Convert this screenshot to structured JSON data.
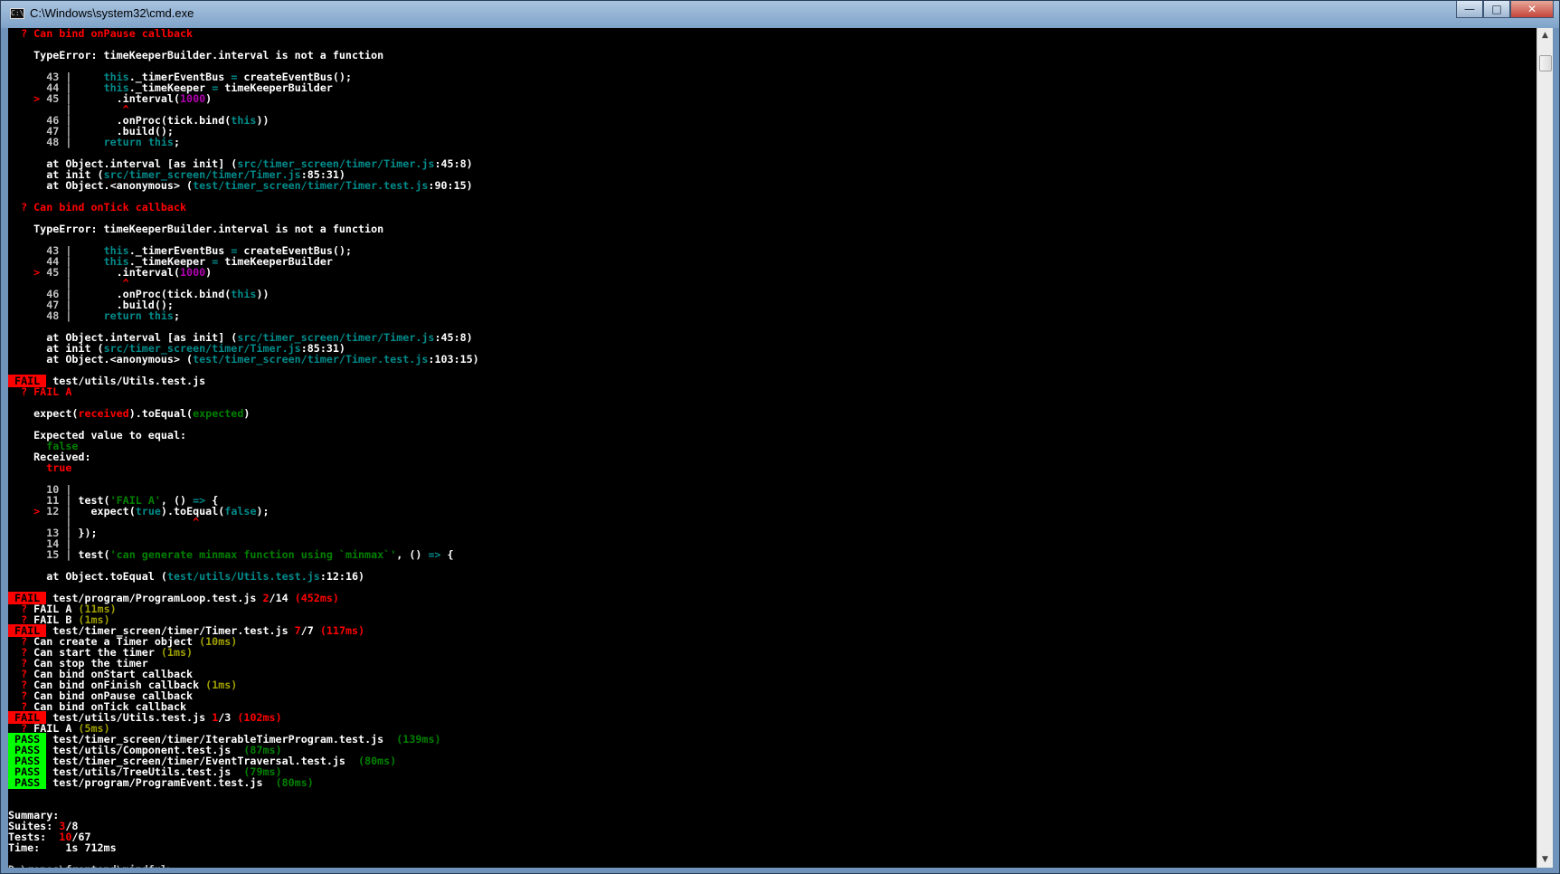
{
  "window": {
    "title": "C:\\Windows\\system32\\cmd.exe",
    "icon": "terminal-icon",
    "controls": {
      "minimize": "—",
      "maximize": "□",
      "close": "✕"
    }
  },
  "colors": {
    "background": "#000000",
    "default": "#c0c0c0",
    "bright": "#ffffff",
    "red": "#ff0000",
    "cyan": "#008b8b",
    "green": "#008000",
    "magenta": "#b000b0",
    "yellow": "#a0a000",
    "fail_badge_bg": "#ff0000",
    "pass_badge_bg": "#00ff00"
  },
  "console": {
    "lines": [
      [
        {
          "t": "  ? Can bind onPause callback",
          "c": "red"
        }
      ],
      [
        {
          "t": ""
        }
      ],
      [
        {
          "t": "    TypeError: timeKeeperBuilder.interval is not a function",
          "c": "bright"
        }
      ],
      [
        {
          "t": ""
        }
      ],
      [
        {
          "t": "      43 |     ",
          "c": "default"
        },
        {
          "t": "this",
          "c": "cyan"
        },
        {
          "t": "._timerEventBus ",
          "c": "bright"
        },
        {
          "t": "=",
          "c": "cyan"
        },
        {
          "t": " createEventBus();",
          "c": "bright"
        }
      ],
      [
        {
          "t": "      44 |     ",
          "c": "default"
        },
        {
          "t": "this",
          "c": "cyan"
        },
        {
          "t": "._timeKeeper ",
          "c": "bright"
        },
        {
          "t": "=",
          "c": "cyan"
        },
        {
          "t": " timeKeeperBuilder",
          "c": "bright"
        }
      ],
      [
        {
          "t": "    > ",
          "c": "red"
        },
        {
          "t": "45 |       ",
          "c": "default"
        },
        {
          "t": ".interval(",
          "c": "bright"
        },
        {
          "t": "1000",
          "c": "magenta"
        },
        {
          "t": ")",
          "c": "bright"
        }
      ],
      [
        {
          "t": "         |        ",
          "c": "default"
        },
        {
          "t": "^",
          "c": "red"
        }
      ],
      [
        {
          "t": "      46 |       ",
          "c": "default"
        },
        {
          "t": ".onProc(tick.bind(",
          "c": "bright"
        },
        {
          "t": "this",
          "c": "cyan"
        },
        {
          "t": "))",
          "c": "bright"
        }
      ],
      [
        {
          "t": "      47 |       ",
          "c": "default"
        },
        {
          "t": ".build();",
          "c": "bright"
        }
      ],
      [
        {
          "t": "      48 |     ",
          "c": "default"
        },
        {
          "t": "return this",
          "c": "cyan"
        },
        {
          "t": ";",
          "c": "bright"
        }
      ],
      [
        {
          "t": ""
        }
      ],
      [
        {
          "t": "      at Object.interval [as init] (",
          "c": "bright"
        },
        {
          "t": "src/timer_screen/timer/Timer.js",
          "c": "cyan"
        },
        {
          "t": ":45:8)",
          "c": "bright"
        }
      ],
      [
        {
          "t": "      at init (",
          "c": "bright"
        },
        {
          "t": "src/timer_screen/timer/Timer.js",
          "c": "cyan"
        },
        {
          "t": ":85:31)",
          "c": "bright"
        }
      ],
      [
        {
          "t": "      at Object.<anonymous> (",
          "c": "bright"
        },
        {
          "t": "test/timer_screen/timer/Timer.test.js",
          "c": "cyan"
        },
        {
          "t": ":90:15)",
          "c": "bright"
        }
      ],
      [
        {
          "t": ""
        }
      ],
      [
        {
          "t": "  ? Can bind onTick callback",
          "c": "red"
        }
      ],
      [
        {
          "t": ""
        }
      ],
      [
        {
          "t": "    TypeError: timeKeeperBuilder.interval is not a function",
          "c": "bright"
        }
      ],
      [
        {
          "t": ""
        }
      ],
      [
        {
          "t": "      43 |     ",
          "c": "default"
        },
        {
          "t": "this",
          "c": "cyan"
        },
        {
          "t": "._timerEventBus ",
          "c": "bright"
        },
        {
          "t": "=",
          "c": "cyan"
        },
        {
          "t": " createEventBus();",
          "c": "bright"
        }
      ],
      [
        {
          "t": "      44 |     ",
          "c": "default"
        },
        {
          "t": "this",
          "c": "cyan"
        },
        {
          "t": "._timeKeeper ",
          "c": "bright"
        },
        {
          "t": "=",
          "c": "cyan"
        },
        {
          "t": " timeKeeperBuilder",
          "c": "bright"
        }
      ],
      [
        {
          "t": "    > ",
          "c": "red"
        },
        {
          "t": "45 |       ",
          "c": "default"
        },
        {
          "t": ".interval(",
          "c": "bright"
        },
        {
          "t": "1000",
          "c": "magenta"
        },
        {
          "t": ")",
          "c": "bright"
        }
      ],
      [
        {
          "t": "         |        ",
          "c": "default"
        },
        {
          "t": "^",
          "c": "red"
        }
      ],
      [
        {
          "t": "      46 |       ",
          "c": "default"
        },
        {
          "t": ".onProc(tick.bind(",
          "c": "bright"
        },
        {
          "t": "this",
          "c": "cyan"
        },
        {
          "t": "))",
          "c": "bright"
        }
      ],
      [
        {
          "t": "      47 |       ",
          "c": "default"
        },
        {
          "t": ".build();",
          "c": "bright"
        }
      ],
      [
        {
          "t": "      48 |     ",
          "c": "default"
        },
        {
          "t": "return this",
          "c": "cyan"
        },
        {
          "t": ";",
          "c": "bright"
        }
      ],
      [
        {
          "t": ""
        }
      ],
      [
        {
          "t": "      at Object.interval [as init] (",
          "c": "bright"
        },
        {
          "t": "src/timer_screen/timer/Timer.js",
          "c": "cyan"
        },
        {
          "t": ":45:8)",
          "c": "bright"
        }
      ],
      [
        {
          "t": "      at init (",
          "c": "bright"
        },
        {
          "t": "src/timer_screen/timer/Timer.js",
          "c": "cyan"
        },
        {
          "t": ":85:31)",
          "c": "bright"
        }
      ],
      [
        {
          "t": "      at Object.<anonymous> (",
          "c": "bright"
        },
        {
          "t": "test/timer_screen/timer/Timer.test.js",
          "c": "cyan"
        },
        {
          "t": ":103:15)",
          "c": "bright"
        }
      ],
      [
        {
          "t": ""
        }
      ],
      [
        {
          "t": " FAIL ",
          "c": "fail"
        },
        {
          "t": " test/utils/",
          "c": "bright"
        },
        {
          "t": "Utils.test.js",
          "c": "bright"
        }
      ],
      [
        {
          "t": "  ? FAIL A",
          "c": "red"
        }
      ],
      [
        {
          "t": ""
        }
      ],
      [
        {
          "t": "    expect(",
          "c": "bright"
        },
        {
          "t": "received",
          "c": "red"
        },
        {
          "t": ").toEqual(",
          "c": "bright"
        },
        {
          "t": "expected",
          "c": "green"
        },
        {
          "t": ")",
          "c": "bright"
        }
      ],
      [
        {
          "t": ""
        }
      ],
      [
        {
          "t": "    Expected value to equal:",
          "c": "bright"
        }
      ],
      [
        {
          "t": "      false",
          "c": "green"
        }
      ],
      [
        {
          "t": "    Received:",
          "c": "bright"
        }
      ],
      [
        {
          "t": "      true",
          "c": "red"
        }
      ],
      [
        {
          "t": ""
        }
      ],
      [
        {
          "t": "      10 |",
          "c": "default"
        }
      ],
      [
        {
          "t": "      11 | ",
          "c": "default"
        },
        {
          "t": "test(",
          "c": "bright"
        },
        {
          "t": "'FAIL A'",
          "c": "green"
        },
        {
          "t": ", () ",
          "c": "bright"
        },
        {
          "t": "=>",
          "c": "cyan"
        },
        {
          "t": " {",
          "c": "bright"
        }
      ],
      [
        {
          "t": "    > ",
          "c": "red"
        },
        {
          "t": "12 |   ",
          "c": "default"
        },
        {
          "t": "expect(",
          "c": "bright"
        },
        {
          "t": "true",
          "c": "cyan"
        },
        {
          "t": ").toEqual(",
          "c": "bright"
        },
        {
          "t": "false",
          "c": "cyan"
        },
        {
          "t": ");",
          "c": "bright"
        }
      ],
      [
        {
          "t": "         |                   ",
          "c": "default"
        },
        {
          "t": "^",
          "c": "red"
        }
      ],
      [
        {
          "t": "      13 | ",
          "c": "default"
        },
        {
          "t": "});",
          "c": "bright"
        }
      ],
      [
        {
          "t": "      14 |",
          "c": "default"
        }
      ],
      [
        {
          "t": "      15 | ",
          "c": "default"
        },
        {
          "t": "test(",
          "c": "bright"
        },
        {
          "t": "'can generate minmax function using `minmax`'",
          "c": "green"
        },
        {
          "t": ", () ",
          "c": "bright"
        },
        {
          "t": "=>",
          "c": "cyan"
        },
        {
          "t": " {",
          "c": "bright"
        }
      ],
      [
        {
          "t": ""
        }
      ],
      [
        {
          "t": "      at Object.toEqual (",
          "c": "bright"
        },
        {
          "t": "test/utils/Utils.test.js",
          "c": "cyan"
        },
        {
          "t": ":12:16)",
          "c": "bright"
        }
      ],
      [
        {
          "t": ""
        }
      ],
      [
        {
          "t": " FAIL ",
          "c": "fail"
        },
        {
          "t": " test/program/",
          "c": "bright"
        },
        {
          "t": "ProgramLoop.test.js ",
          "c": "bright"
        },
        {
          "t": "2",
          "c": "red"
        },
        {
          "t": "/14 ",
          "c": "bright"
        },
        {
          "t": "(452ms)",
          "c": "red"
        }
      ],
      [
        {
          "t": "  ? ",
          "c": "red"
        },
        {
          "t": "FAIL A ",
          "c": "bright"
        },
        {
          "t": "(11ms)",
          "c": "yellow"
        }
      ],
      [
        {
          "t": "  ? ",
          "c": "red"
        },
        {
          "t": "FAIL B ",
          "c": "bright"
        },
        {
          "t": "(1ms)",
          "c": "yellow"
        }
      ],
      [
        {
          "t": " FAIL ",
          "c": "fail"
        },
        {
          "t": " test/timer_screen/timer/",
          "c": "bright"
        },
        {
          "t": "Timer.test.js ",
          "c": "bright"
        },
        {
          "t": "7",
          "c": "red"
        },
        {
          "t": "/7 ",
          "c": "bright"
        },
        {
          "t": "(117ms)",
          "c": "red"
        }
      ],
      [
        {
          "t": "  ? ",
          "c": "red"
        },
        {
          "t": "Can create a Timer object ",
          "c": "bright"
        },
        {
          "t": "(10ms)",
          "c": "yellow"
        }
      ],
      [
        {
          "t": "  ? ",
          "c": "red"
        },
        {
          "t": "Can start the timer ",
          "c": "bright"
        },
        {
          "t": "(1ms)",
          "c": "yellow"
        }
      ],
      [
        {
          "t": "  ? ",
          "c": "red"
        },
        {
          "t": "Can stop the timer",
          "c": "bright"
        }
      ],
      [
        {
          "t": "  ? ",
          "c": "red"
        },
        {
          "t": "Can bind onStart callback",
          "c": "bright"
        }
      ],
      [
        {
          "t": "  ? ",
          "c": "red"
        },
        {
          "t": "Can bind onFinish callback ",
          "c": "bright"
        },
        {
          "t": "(1ms)",
          "c": "yellow"
        }
      ],
      [
        {
          "t": "  ? ",
          "c": "red"
        },
        {
          "t": "Can bind onPause callback",
          "c": "bright"
        }
      ],
      [
        {
          "t": "  ? ",
          "c": "red"
        },
        {
          "t": "Can bind onTick callback",
          "c": "bright"
        }
      ],
      [
        {
          "t": " FAIL ",
          "c": "fail"
        },
        {
          "t": " test/utils/",
          "c": "bright"
        },
        {
          "t": "Utils.test.js ",
          "c": "bright"
        },
        {
          "t": "1",
          "c": "red"
        },
        {
          "t": "/3 ",
          "c": "bright"
        },
        {
          "t": "(102ms)",
          "c": "red"
        }
      ],
      [
        {
          "t": "  ? ",
          "c": "red"
        },
        {
          "t": "FAIL A ",
          "c": "bright"
        },
        {
          "t": "(5ms)",
          "c": "yellow"
        }
      ],
      [
        {
          "t": " PASS ",
          "c": "pass"
        },
        {
          "t": " test/timer_screen/timer/",
          "c": "bright"
        },
        {
          "t": "IterableTimerProgram.test.js ",
          "c": "bright"
        },
        {
          "t": " (139ms)",
          "c": "green"
        }
      ],
      [
        {
          "t": " PASS ",
          "c": "pass"
        },
        {
          "t": " test/utils/",
          "c": "bright"
        },
        {
          "t": "Component.test.js ",
          "c": "bright"
        },
        {
          "t": " (87ms)",
          "c": "green"
        }
      ],
      [
        {
          "t": " PASS ",
          "c": "pass"
        },
        {
          "t": " test/timer_screen/timer/",
          "c": "bright"
        },
        {
          "t": "EventTraversal.test.js ",
          "c": "bright"
        },
        {
          "t": " (80ms)",
          "c": "green"
        }
      ],
      [
        {
          "t": " PASS ",
          "c": "pass"
        },
        {
          "t": " test/utils/",
          "c": "bright"
        },
        {
          "t": "TreeUtils.test.js ",
          "c": "bright"
        },
        {
          "t": " (79ms)",
          "c": "green"
        }
      ],
      [
        {
          "t": " PASS ",
          "c": "pass"
        },
        {
          "t": " test/program/",
          "c": "bright"
        },
        {
          "t": "ProgramEvent.test.js ",
          "c": "bright"
        },
        {
          "t": " (80ms)",
          "c": "green"
        }
      ],
      [
        {
          "t": ""
        }
      ],
      [
        {
          "t": ""
        }
      ],
      [
        {
          "t": "Summary:",
          "c": "bright"
        }
      ],
      [
        {
          "t": "Suites: ",
          "c": "bright"
        },
        {
          "t": "3",
          "c": "red"
        },
        {
          "t": "/8",
          "c": "bright"
        }
      ],
      [
        {
          "t": "Tests:  ",
          "c": "bright"
        },
        {
          "t": "10",
          "c": "red"
        },
        {
          "t": "/67",
          "c": "bright"
        }
      ],
      [
        {
          "t": "Time:    1s 712ms",
          "c": "bright"
        }
      ],
      [
        {
          "t": ""
        }
      ],
      [
        {
          "t": "D:\\repos\\frontend\\mindful>",
          "c": "default"
        },
        {
          "t": "_",
          "c": "bright"
        }
      ]
    ]
  }
}
